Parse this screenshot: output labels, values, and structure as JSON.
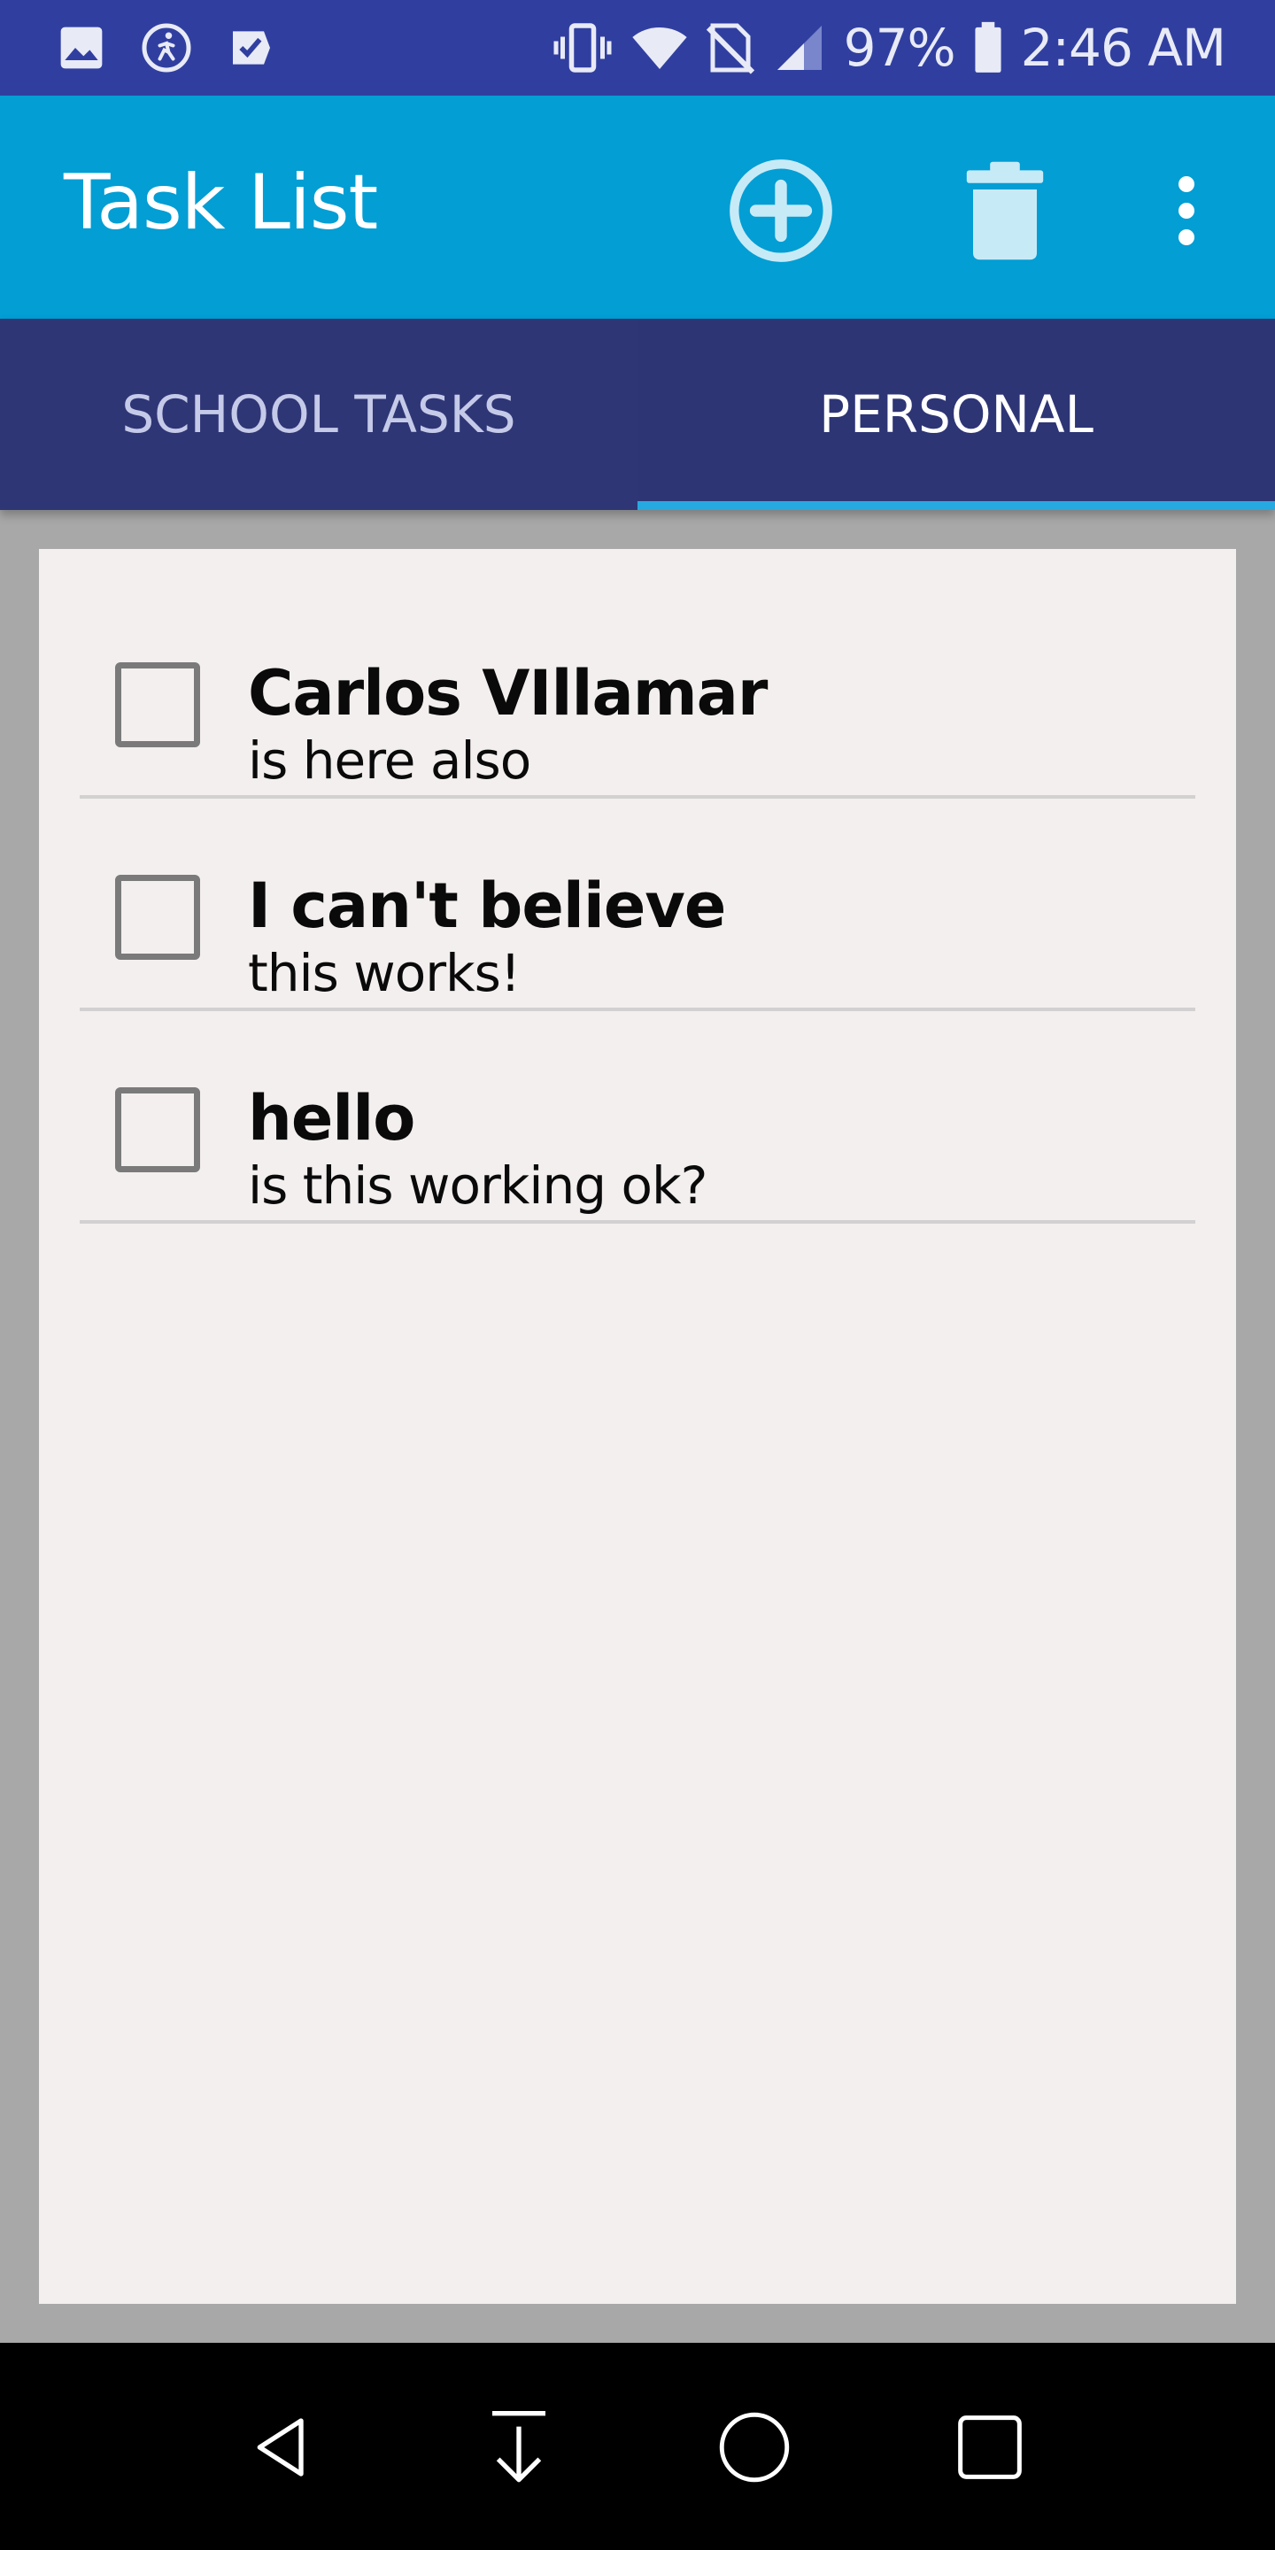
{
  "status_bar": {
    "battery_percent": "97%",
    "time": "2:46 AM",
    "left_icons": [
      "gallery-icon",
      "activity-icon",
      "task-check-icon"
    ],
    "right_icons": [
      "vibrate-icon",
      "wifi-icon",
      "no-sim-icon",
      "signal-icon",
      "battery-icon"
    ],
    "background_color": "#303f9f"
  },
  "app_bar": {
    "title": "Task List",
    "actions": [
      "add-circle-icon",
      "trash-icon",
      "more-vert-icon"
    ],
    "background_color": "#029ed4"
  },
  "tabs": [
    {
      "label": "SCHOOL TASKS",
      "selected": false
    },
    {
      "label": "PERSONAL",
      "selected": true
    }
  ],
  "tasks": [
    {
      "title": "Carlos VIllamar",
      "subtitle": "is here also",
      "checked": false
    },
    {
      "title": "I can't believe",
      "subtitle": "this works!",
      "checked": false
    },
    {
      "title": "hello",
      "subtitle": "is this working ok?",
      "checked": false
    }
  ],
  "nav_bar": {
    "buttons": [
      "back-icon",
      "download-icon",
      "home-icon",
      "recents-icon"
    ]
  }
}
